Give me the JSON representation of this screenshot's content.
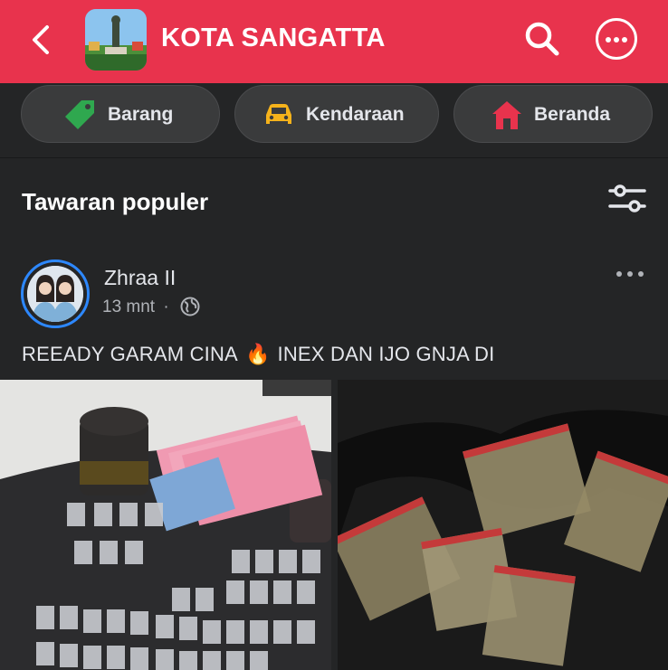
{
  "header": {
    "title": "KOTA SANGATTA",
    "bg_color": "#e8334d",
    "icons": [
      "back-arrow-icon",
      "search-icon",
      "more-icon"
    ]
  },
  "chips": [
    {
      "label": "Barang",
      "icon": "tag-icon",
      "color": "#2fa84f"
    },
    {
      "label": "Kendaraan",
      "icon": "car-icon",
      "color": "#f5b21b"
    },
    {
      "label": "Beranda",
      "icon": "home-icon",
      "color": "#e8334d"
    }
  ],
  "section": {
    "title": "Tawaran populer",
    "filter_icon": "filter-icon"
  },
  "post": {
    "author": "Zhraa II",
    "time": "13 mnt",
    "separator": "·",
    "visibility_icon": "globe-icon",
    "text_before": "REEADY GARAM CINA",
    "emoji": "🔥",
    "text_after": "INEX DAN IJO GNJA DI"
  }
}
